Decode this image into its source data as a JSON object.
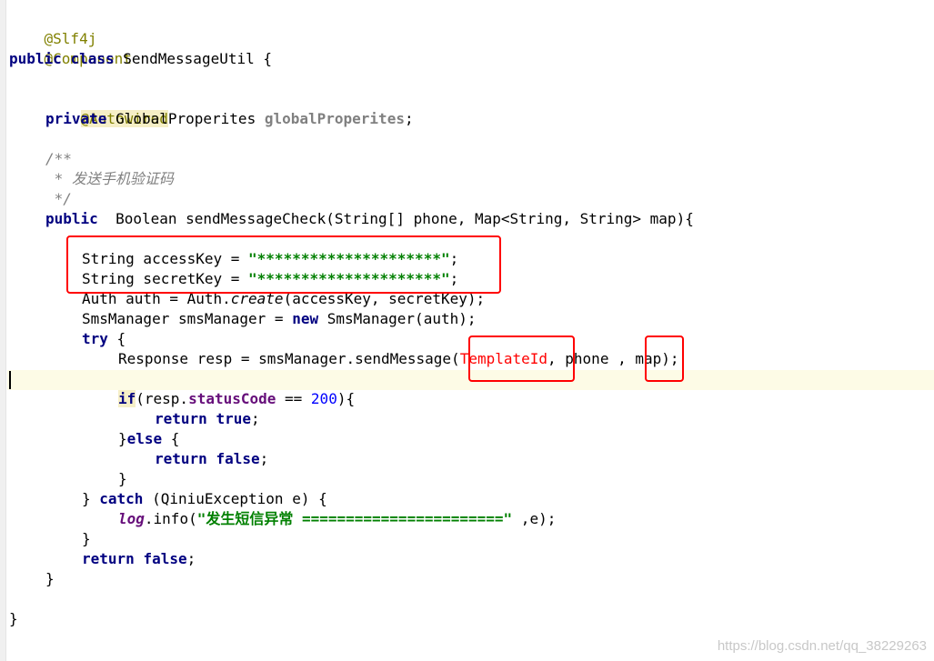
{
  "code": {
    "l1_annotation": "@Slf4j",
    "l2_annotation": "@Component",
    "l3_public": "public",
    "l3_class": "class",
    "l3_rest": " SendMessageUtil {",
    "l5_annotation": "@Autowired",
    "l6_private": "private",
    "l6_type": " GlobalProperites ",
    "l6_field": "globalProperites",
    "l6_end": ";",
    "l8_comment": "/**",
    "l9_comment": " * 发送手机验证码",
    "l10_comment": " */",
    "l11_public": "public",
    "l11_rest": "  Boolean sendMessageCheck(String[] phone, Map<String, String> map){",
    "l13_pre": "String accessKey = ",
    "l13_str": "\"*********************\"",
    "l13_end": ";",
    "l14_pre": "String secretKey = ",
    "l14_str": "\"*********************\"",
    "l14_end": ";",
    "l15_pre": "Auth auth = Auth.",
    "l15_static": "create",
    "l15_end": "(accessKey, secretKey);",
    "l16_pre": "SmsManager smsManager = ",
    "l16_new": "new",
    "l16_end": " SmsManager(auth);",
    "l17_try": "try",
    "l17_end": " {",
    "l18_pre": "Response resp = smsManager.sendMessage(",
    "l18_red": "TemplateId",
    "l18_mid": ", phone , ",
    "l18_map": "map",
    "l18_end": ");",
    "l20_if": "if",
    "l20_pre": "(resp.",
    "l20_field": "statusCode",
    "l20_op": " == ",
    "l20_num": "200",
    "l20_end": "){",
    "l21_return": "return",
    "l21_true": "true",
    "l21_end": ";",
    "l22_open": "}",
    "l22_else": "else",
    "l22_end": " {",
    "l23_return": "return",
    "l23_false": "false",
    "l23_end": ";",
    "l24_close": "}",
    "l25_pre": "} ",
    "l25_catch": "catch",
    "l25_end": " (QiniuException e) {",
    "l26_log": "log",
    "l26_mid": ".info(",
    "l26_str": "\"发生短信异常 =======================\"",
    "l26_end": " ,e);",
    "l27_close": "}",
    "l28_return": "return",
    "l28_false": "false",
    "l28_end": ";",
    "l29_close": "}",
    "l31_close": "}"
  },
  "watermark": "https://blog.csdn.net/qq_38229263",
  "colors": {
    "keyword": "#000080",
    "annotation": "#808000",
    "string": "#008000",
    "comment": "#808080",
    "number": "#0000ff",
    "field": "#660e7a",
    "highlight_box": "#ff0000",
    "caret_line": "#fdfbe6"
  }
}
